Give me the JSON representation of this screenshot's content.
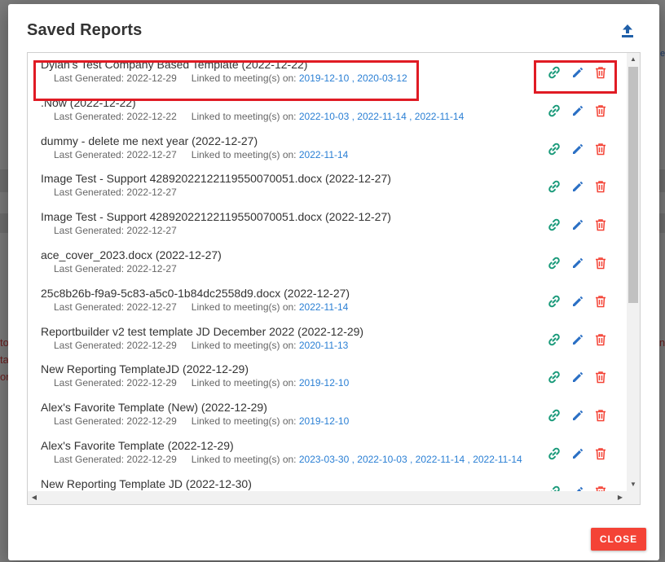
{
  "dialog": {
    "title": "Saved Reports",
    "upload_icon": "upload-icon",
    "close_label": "CLOSE"
  },
  "labels": {
    "last_generated": "Last Generated: ",
    "linked": "Linked to meeting(s) on: "
  },
  "icons": {
    "link": "link-icon",
    "edit": "pencil-icon",
    "delete": "trash-icon"
  },
  "colors": {
    "link_icon": "#1a9a7a",
    "edit_icon": "#2a6fc4",
    "delete_icon": "#f44336",
    "meeting_link": "#2a7fd4",
    "highlight": "#e01b24",
    "close_button": "#f44336"
  },
  "reports": [
    {
      "title": "Dylan's Test Company Based Template (2022-12-22)",
      "last_generated": "2022-12-29",
      "meetings": [
        "2019-12-10",
        "2020-03-12"
      ]
    },
    {
      "title": ".Now (2022-12-22)",
      "last_generated": "2022-12-22",
      "meetings": [
        "2022-10-03",
        "2022-11-14",
        "2022-11-14"
      ]
    },
    {
      "title": "dummy - delete me next year (2022-12-27)",
      "last_generated": "2022-12-27",
      "meetings": [
        "2022-11-14"
      ]
    },
    {
      "title": "Image Test - Support 42892022122119550070051.docx (2022-12-27)",
      "last_generated": "2022-12-27",
      "meetings": []
    },
    {
      "title": "Image Test - Support 42892022122119550070051.docx (2022-12-27)",
      "last_generated": "2022-12-27",
      "meetings": []
    },
    {
      "title": "ace_cover_2023.docx (2022-12-27)",
      "last_generated": "2022-12-27",
      "meetings": []
    },
    {
      "title": "25c8b26b-f9a9-5c83-a5c0-1b84dc2558d9.docx (2022-12-27)",
      "last_generated": "2022-12-27",
      "meetings": [
        "2022-11-14"
      ]
    },
    {
      "title": "Reportbuilder v2 test template JD December 2022 (2022-12-29)",
      "last_generated": "2022-12-29",
      "meetings": [
        "2020-11-13"
      ]
    },
    {
      "title": "New Reporting TemplateJD (2022-12-29)",
      "last_generated": "2022-12-29",
      "meetings": [
        "2019-12-10"
      ]
    },
    {
      "title": "Alex's Favorite Template (New) (2022-12-29)",
      "last_generated": "2022-12-29",
      "meetings": [
        "2019-12-10"
      ]
    },
    {
      "title": "Alex's Favorite Template (2022-12-29)",
      "last_generated": "2022-12-29",
      "meetings": [
        "2023-03-30",
        "2022-10-03",
        "2022-11-14",
        "2022-11-14"
      ]
    },
    {
      "title": "New Reporting Template JD (2022-12-30)",
      "last_generated": "",
      "meetings": []
    }
  ],
  "background_fragments": [
    "to",
    "ta",
    "on",
    "in",
    "e"
  ]
}
